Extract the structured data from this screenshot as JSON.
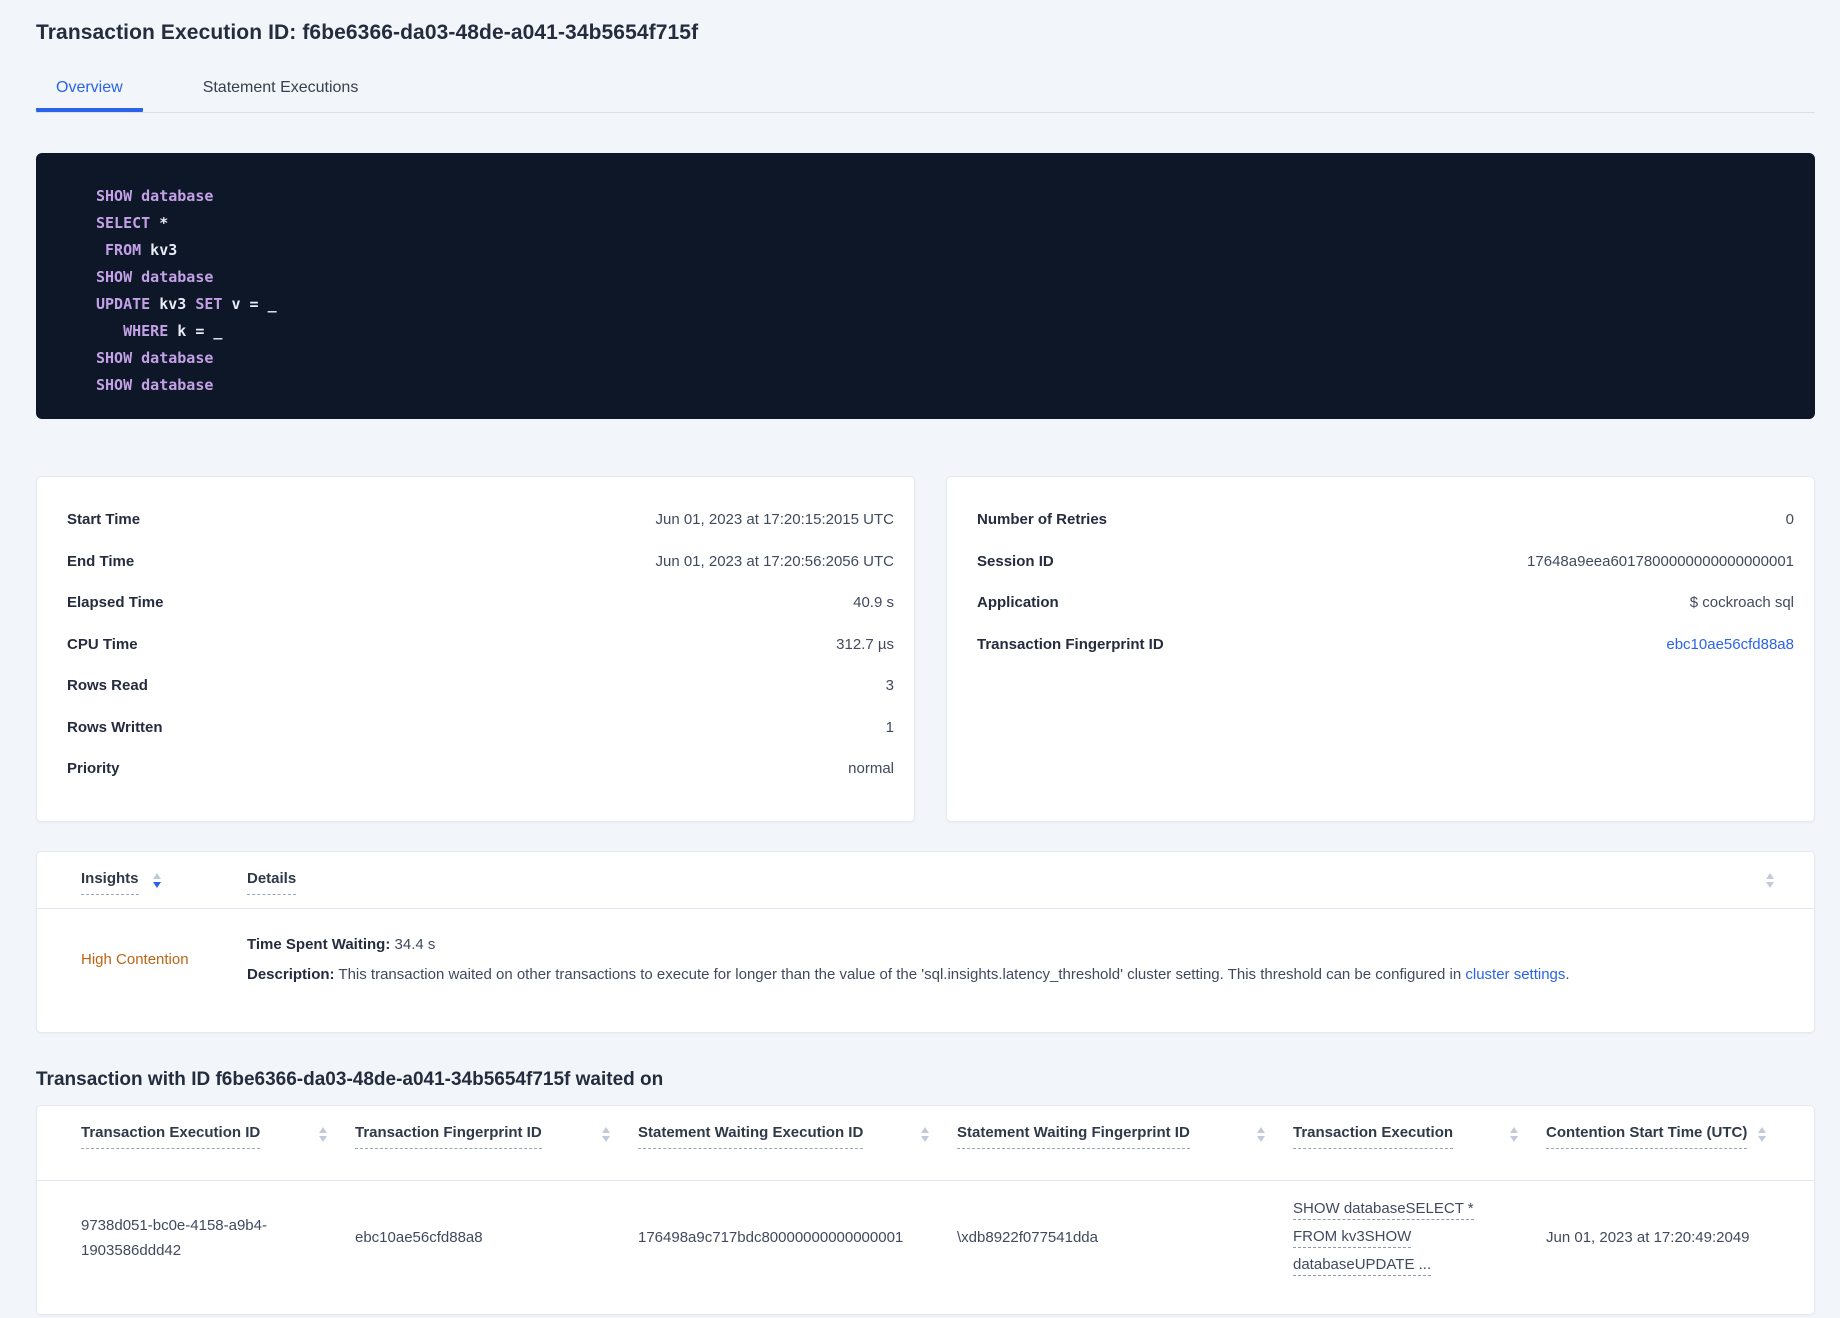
{
  "page_title": "Transaction Execution ID: f6be6366-da03-48de-a041-34b5654f715f",
  "tabs": {
    "overview": "Overview",
    "statement_executions": "Statement Executions"
  },
  "sql": {
    "lines": [
      {
        "segs": [
          {
            "text": "SHOW database",
            "type": "keyword"
          }
        ]
      },
      {
        "segs": [
          {
            "text": "SELECT",
            "type": "keyword"
          },
          {
            "text": " *",
            "type": "plain"
          }
        ]
      },
      {
        "segs": [
          {
            "text": " ",
            "type": "plain"
          },
          {
            "text": "FROM",
            "type": "keyword"
          },
          {
            "text": " kv3",
            "type": "plain"
          }
        ]
      },
      {
        "segs": [
          {
            "text": "SHOW database",
            "type": "keyword"
          }
        ]
      },
      {
        "segs": [
          {
            "text": "UPDATE",
            "type": "keyword"
          },
          {
            "text": " kv3 ",
            "type": "plain"
          },
          {
            "text": "SET",
            "type": "keyword"
          },
          {
            "text": " v = _",
            "type": "plain"
          }
        ]
      },
      {
        "segs": [
          {
            "text": "   ",
            "type": "plain"
          },
          {
            "text": "WHERE",
            "type": "keyword"
          },
          {
            "text": " k = _",
            "type": "plain"
          }
        ]
      },
      {
        "segs": [
          {
            "text": "SHOW database",
            "type": "keyword"
          }
        ]
      },
      {
        "segs": [
          {
            "text": "SHOW database",
            "type": "keyword"
          }
        ]
      }
    ]
  },
  "details_card": {
    "rows": [
      {
        "label": "Start Time",
        "value": "Jun 01, 2023 at 17:20:15:2015 UTC"
      },
      {
        "label": "End Time",
        "value": "Jun 01, 2023 at 17:20:56:2056 UTC"
      },
      {
        "label": "Elapsed Time",
        "value": "40.9 s"
      },
      {
        "label": "CPU Time",
        "value": "312.7 µs"
      },
      {
        "label": "Rows Read",
        "value": "3"
      },
      {
        "label": "Rows Written",
        "value": "1"
      },
      {
        "label": "Priority",
        "value": "normal"
      }
    ]
  },
  "meta_card": {
    "rows": [
      {
        "label": "Number of Retries",
        "value": "0"
      },
      {
        "label": "Session ID",
        "value": "17648a9eea6017800000000000000001"
      },
      {
        "label": "Application",
        "value": "$ cockroach sql"
      },
      {
        "label": "Transaction Fingerprint ID",
        "value": "ebc10ae56cfd88a8",
        "is_link": true
      }
    ]
  },
  "insights_table": {
    "insights_col": "Insights",
    "details_col": "Details",
    "row": {
      "insight": "High Contention",
      "waiting_label": "Time Spent Waiting:",
      "waiting_value": " 34.4 s",
      "desc_label": "Description:",
      "desc_text": " This transaction waited on other transactions to execute for longer than the value of the 'sql.insights.latency_threshold' cluster setting. This threshold can be configured in ",
      "desc_link": "cluster settings",
      "desc_end": "."
    }
  },
  "waited_on": {
    "heading": "Transaction with ID f6be6366-da03-48de-a041-34b5654f715f waited on",
    "columns": [
      "Transaction Execution ID",
      "Transaction Fingerprint ID",
      "Statement Waiting Execution ID",
      "Statement Waiting Fingerprint ID",
      "Transaction Execution",
      "Contention Start Time (UTC)"
    ],
    "row": {
      "txn_execution_id": "9738d051-bc0e-4158-a9b4-1903586ddd42",
      "txn_fingerprint_id": "ebc10ae56cfd88a8",
      "stmt_waiting_execution_id": "176498a9c717bdc80000000000000001",
      "stmt_waiting_fingerprint_id": "\\xdb8922f077541dda",
      "txn_execution_lines": [
        "SHOW databaseSELECT *",
        "FROM kv3SHOW",
        "databaseUPDATE ..."
      ],
      "contention_start_time": "Jun 01, 2023 at 17:20:49:2049"
    }
  },
  "colors": {
    "accent_blue": "#2b63e8",
    "contention_orange": "#bd6414",
    "code_keyword_purple": "#c3a1e6",
    "code_background": "#0e1728",
    "page_background": "#f2f5f9"
  }
}
